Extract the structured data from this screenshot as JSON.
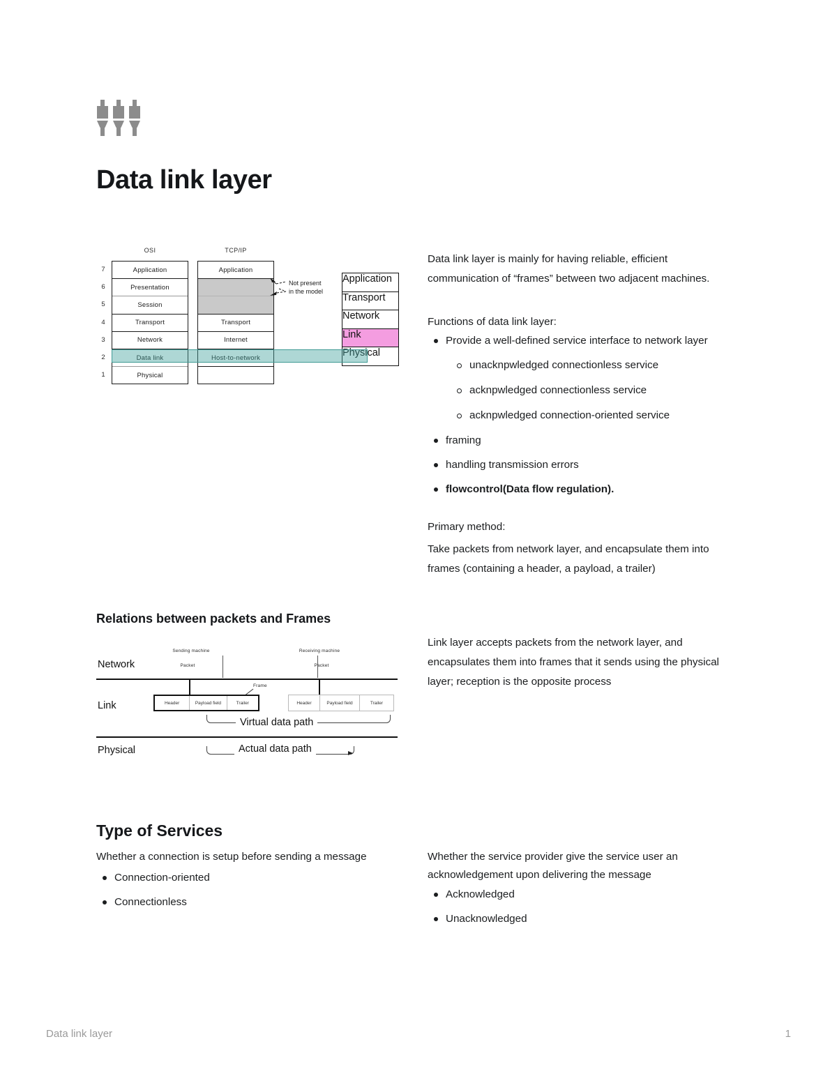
{
  "document": {
    "title": "Data link layer",
    "icon": "plugs-icon",
    "footer_left": "Data link layer",
    "footer_page": "1"
  },
  "osi_figure": {
    "osi_caption": "OSI",
    "tcpip_caption": "TCP/IP",
    "layer_numbers": [
      "7",
      "6",
      "5",
      "4",
      "3",
      "2",
      "1"
    ],
    "osi_layers": [
      "Application",
      "Presentation",
      "Session",
      "Transport",
      "Network",
      "Data link",
      "Physical"
    ],
    "tcpip_layers": [
      "Application",
      "",
      "",
      "Transport",
      "Internet",
      "Host-to-network",
      ""
    ],
    "annotation": "Not present\nin the model",
    "annotation_line1": "Not present",
    "annotation_line2": "in the model",
    "right_stack": [
      "Application",
      "Transport",
      "Network",
      "Link",
      "Physical"
    ],
    "highlight_layer": "Data link",
    "highlight_color": "#3f9a94",
    "link_color": "#f49de0",
    "shaded_color": "#c9c9c9"
  },
  "intro": {
    "paragraph": "Data link layer is mainly for having reliable, efficient communication of “frames” between two adjacent machines.",
    "functions_heading": "Functions of data link layer:",
    "functions": [
      {
        "text": "Provide a well-defined service interface to network layer",
        "level": 1,
        "bold": false
      },
      {
        "text": "unacknpwledged connectionless service",
        "level": 2,
        "bold": false
      },
      {
        "text": "acknpwledged connectionless service",
        "level": 2,
        "bold": false
      },
      {
        "text": "acknpwledged connection-oriented service",
        "level": 2,
        "bold": false
      },
      {
        "text": "framing",
        "level": 1,
        "bold": false
      },
      {
        "text": "handling transmission errors",
        "level": 1,
        "bold": false
      },
      {
        "text": "flowcontrol(Data flow regulation).",
        "level": 1,
        "bold": true
      }
    ],
    "primary_method_heading": "Primary method:",
    "primary_method_body": "Take packets from network layer, and encapsulate them into frames (containing a header, a payload, a trailer)"
  },
  "relations": {
    "heading": "Relations between packets and Frames",
    "right_paragraph": "Link layer accepts packets from the network layer, and encapsulates them into frames that it sends using the physical layer; reception is the opposite process",
    "figure": {
      "row_labels": [
        "Network",
        "Link",
        "Physical"
      ],
      "sending_machine": "Sending machine",
      "receiving_machine": "Receiving machine",
      "packet_label": "Packet",
      "frame_label": "Frame",
      "frame_cells": [
        "Header",
        "Payload field",
        "Trailer"
      ],
      "virtual_path": "Virtual data path",
      "actual_path": "Actual data path"
    }
  },
  "type_of_services": {
    "heading": "Type of Services",
    "left_intro": "Whether a connection is setup before sending a message",
    "left_items": [
      "Connection-oriented",
      "Connectionless"
    ],
    "right_intro": "Whether the service provider give the service user an acknowledgement upon delivering the message",
    "right_items": [
      "Acknowledged",
      "Unacknowledged"
    ]
  }
}
